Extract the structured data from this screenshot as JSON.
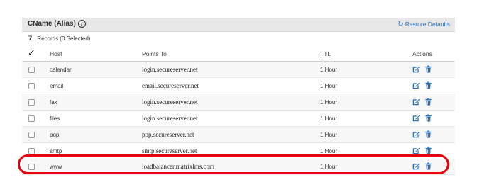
{
  "panel": {
    "title": "CName (Alias)",
    "restore_label": "Restore Defaults",
    "record_count": "7",
    "records_status": "Records (0 Selected)"
  },
  "columns": {
    "host": "Host",
    "points_to": "Points To",
    "ttl": "TTL",
    "actions": "Actions"
  },
  "rows": [
    {
      "host": "calendar",
      "points_to": "login.secureserver.net",
      "ttl": "1 Hour"
    },
    {
      "host": "email",
      "points_to": "email.secureserver.net",
      "ttl": "1 Hour"
    },
    {
      "host": "fax",
      "points_to": "login.secureserver.net",
      "ttl": "1 Hour"
    },
    {
      "host": "files",
      "points_to": "login.secureserver.net",
      "ttl": "1 Hour"
    },
    {
      "host": "pop",
      "points_to": "pop.secureserver.net",
      "ttl": "1 Hour"
    },
    {
      "host": "smtp",
      "points_to": "smtp.secureserver.net",
      "ttl": "1 Hour"
    },
    {
      "host": "www",
      "points_to": "loadbalancer.matrixlms.com",
      "ttl": "1 Hour"
    }
  ],
  "colors": {
    "accent": "#2a6ebb",
    "highlight": "#e8000a",
    "header_bg": "#e8e8e8"
  },
  "icons": {
    "info": "info-icon",
    "restore": "refresh-icon",
    "select_all": "checkmark-icon",
    "edit": "edit-icon",
    "delete": "trash-icon"
  }
}
